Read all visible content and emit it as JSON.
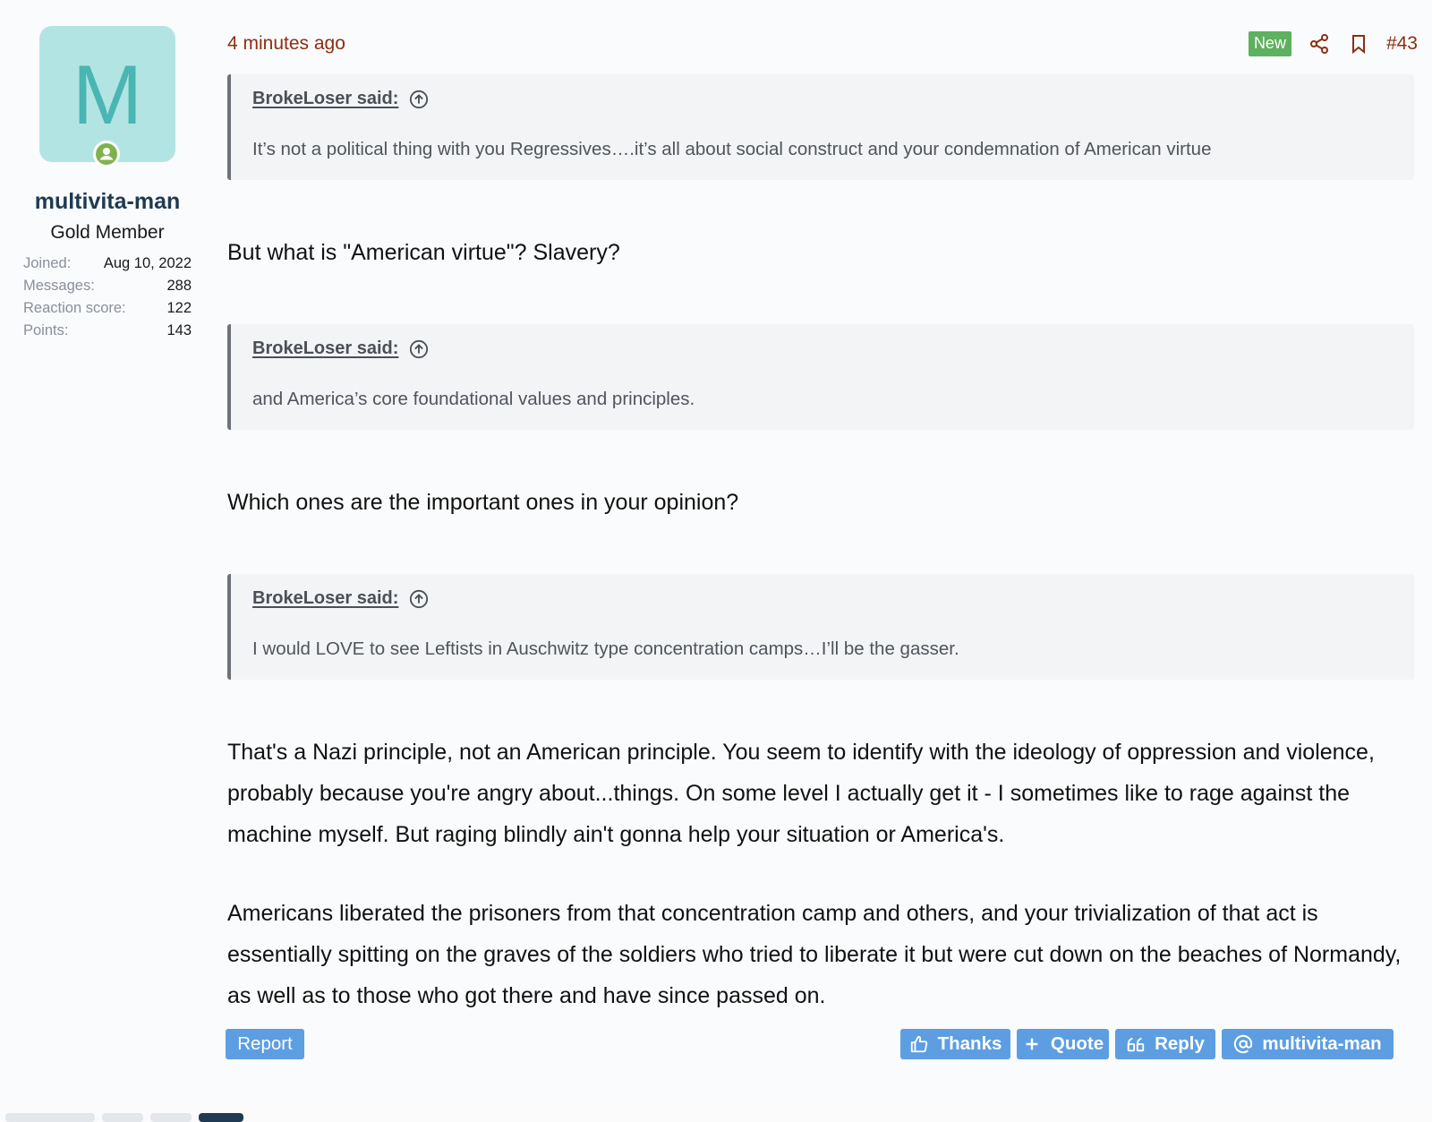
{
  "user": {
    "avatar_letter": "M",
    "name": "multivita-man",
    "title": "Gold Member",
    "stats": [
      {
        "label": "Joined:",
        "value": "Aug 10, 2022"
      },
      {
        "label": "Messages:",
        "value": "288"
      },
      {
        "label": "Reaction score:",
        "value": "122"
      },
      {
        "label": "Points:",
        "value": "143"
      }
    ]
  },
  "header": {
    "date": "4 minutes ago",
    "new_badge": "New",
    "post_number": "#43"
  },
  "quotes": [
    {
      "author": "BrokeLoser said:",
      "text": "It’s not a political thing with you Regressives….it’s all about social construct and your condemnation of American virtue"
    },
    {
      "author": "BrokeLoser said:",
      "text": "and America’s core foundational values and principles."
    },
    {
      "author": "BrokeLoser said:",
      "text": "I would LOVE to see Leftists in Auschwitz type concentration camps…I’ll be the gasser."
    }
  ],
  "messages": {
    "reply1": "But what is \"American virtue\"? Slavery?",
    "reply2": "Which ones are the important ones in your opinion?",
    "reply3": "That's a Nazi principle, not an American principle. You seem to identify with the ideology of oppression and violence, probably because you're angry about...things. On some level I actually get it - I sometimes like to rage against the machine myself. But raging blindly ain't gonna help your situation or America's.",
    "reply4": "Americans liberated the prisoners from that concentration camp and others, and your trivialization of that act is essentially spitting on the graves of the soldiers who tried to liberate it but were cut down on the beaches of Normandy, as well as to those who got there and have since passed on."
  },
  "footer": {
    "report": "Report",
    "thanks": "Thanks",
    "quote": "Quote",
    "reply": "Reply",
    "mention": "multivita-man"
  },
  "colors": {
    "accent_button": "#5d9ee2",
    "date_text": "#8c2e12",
    "new_badge": "#5eb15e",
    "avatar_bg": "#b3e4e4"
  },
  "icons": [
    "online-user-icon",
    "share-icon",
    "bookmark-icon",
    "arrow-up-circle-icon",
    "thumbs-up-icon",
    "plus-icon",
    "quote-marks-icon",
    "at-icon"
  ]
}
